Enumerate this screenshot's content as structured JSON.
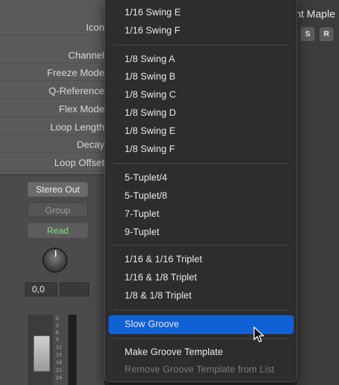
{
  "inspector": {
    "rows": [
      "Icon",
      "Channel",
      "Freeze Mode",
      "Q-Reference",
      "Flex Mode",
      "Loop Length",
      "Decay",
      "Loop Offset"
    ]
  },
  "channel_strip": {
    "output": "Stereo Out",
    "group": "Group",
    "automation": "Read",
    "volume_value": "0,0",
    "meter_ticks": [
      "0",
      "3",
      "6",
      "9",
      "12",
      "15",
      "18",
      "21",
      "24"
    ]
  },
  "track": {
    "name": "nt Maple",
    "solo_label": "S",
    "record_label": "R"
  },
  "menu": {
    "items": [
      {
        "label": "1/16 Swing E"
      },
      {
        "label": "1/16 Swing F"
      },
      {
        "label": "1/8 Swing A"
      },
      {
        "label": "1/8 Swing B"
      },
      {
        "label": "1/8 Swing C"
      },
      {
        "label": "1/8 Swing D"
      },
      {
        "label": "1/8 Swing E"
      },
      {
        "label": "1/8 Swing F"
      },
      {
        "label": "5-Tuplet/4"
      },
      {
        "label": "5-Tuplet/8"
      },
      {
        "label": "7-Tuplet"
      },
      {
        "label": "9-Tuplet"
      },
      {
        "label": "1/16 & 1/16 Triplet"
      },
      {
        "label": "1/16 & 1/8 Triplet"
      },
      {
        "label": "1/8 & 1/8 Triplet"
      },
      {
        "label": "Slow Groove",
        "highlighted": true
      },
      {
        "label": "Make Groove Template"
      },
      {
        "label": "Remove Groove Template from List",
        "disabled": true
      }
    ],
    "highlight_color": "#1060d6"
  },
  "colors": {
    "accent": "#1060d6",
    "read_text": "#7ce07c"
  }
}
